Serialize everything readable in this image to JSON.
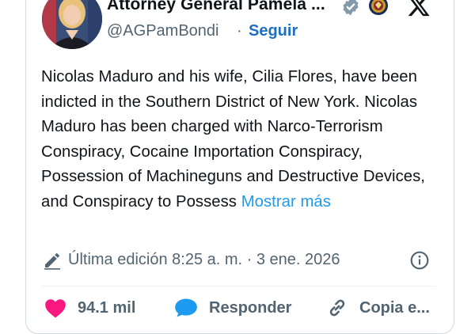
{
  "author": {
    "name": "Attorney General Pamela ...",
    "handle": "@AGPamBondi",
    "separator": "·",
    "follow_label": "Seguir"
  },
  "icons": {
    "verified": "verified-badge-icon",
    "affiliation": "doj-seal-icon",
    "platform": "x-logo-icon",
    "edit": "pencil-icon",
    "info": "info-icon",
    "like": "heart-icon",
    "reply": "reply-bubble-icon",
    "copy": "link-icon"
  },
  "colors": {
    "like": "#f91880",
    "reply": "#1d9bf0",
    "link": "#1d9bf0",
    "verified": "#829aab"
  },
  "post": {
    "text": "Nicolas Maduro and his wife, Cilia Flores, have been indicted in the Southern District of New York.  Nicolas Maduro has been charged with Narco-Terrorism Conspiracy, Cocaine Importation Conspiracy, Possession of Machineguns and Destructive Devices, and Conspiracy to Possess",
    "show_more": "Mostrar más",
    "edited_label": "Última edición 8:25 a. m. · 3 ene. 2026"
  },
  "actions": {
    "likes": "94.1 mil",
    "reply_label": "Responder",
    "copy_label": "Copia e..."
  }
}
